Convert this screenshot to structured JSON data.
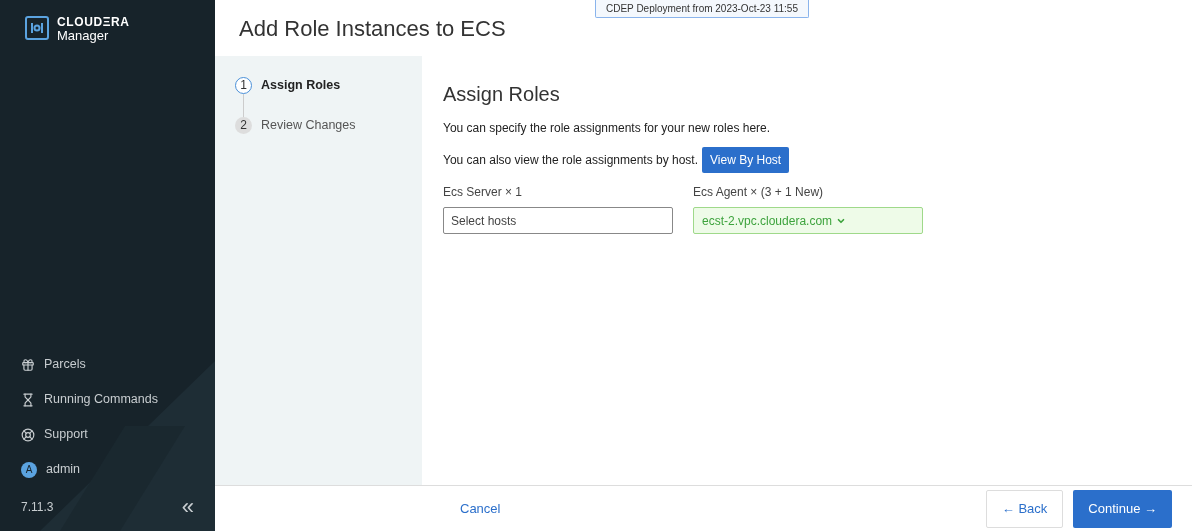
{
  "brand": {
    "name": "CLOUDΞRA",
    "product": "Manager"
  },
  "banner": "CDEP Deployment from 2023-Oct-23 11:55",
  "title": "Add Role Instances to ECS",
  "steps": [
    {
      "number": "1",
      "label": "Assign Roles",
      "selected": true
    },
    {
      "number": "2",
      "label": "Review Changes",
      "selected": false
    }
  ],
  "sidebar": {
    "items": [
      {
        "kind": "parcels",
        "label": "Parcels"
      },
      {
        "kind": "commands",
        "label": "Running Commands"
      },
      {
        "kind": "support",
        "label": "Support"
      },
      {
        "kind": "user",
        "avatar": "A",
        "label": "admin"
      }
    ],
    "version": "7.11.3",
    "collapse": "«"
  },
  "content": {
    "heading": "Assign Roles",
    "intro": "You can specify the role assignments for your new roles here.",
    "by_host_text": "You can also view the role assignments by host.",
    "by_host_button": "View By Host",
    "roles": [
      {
        "label": "Ecs Server × 1",
        "placeholder": "Select hosts",
        "assigned": false
      },
      {
        "label": "Ecs Agent × (3 + 1 New)",
        "value": "ecst-2.vpc.cloudera.com",
        "assigned": true
      }
    ]
  },
  "footer": {
    "cancel": "Cancel",
    "back": "← Back",
    "continue": "Continue →"
  }
}
